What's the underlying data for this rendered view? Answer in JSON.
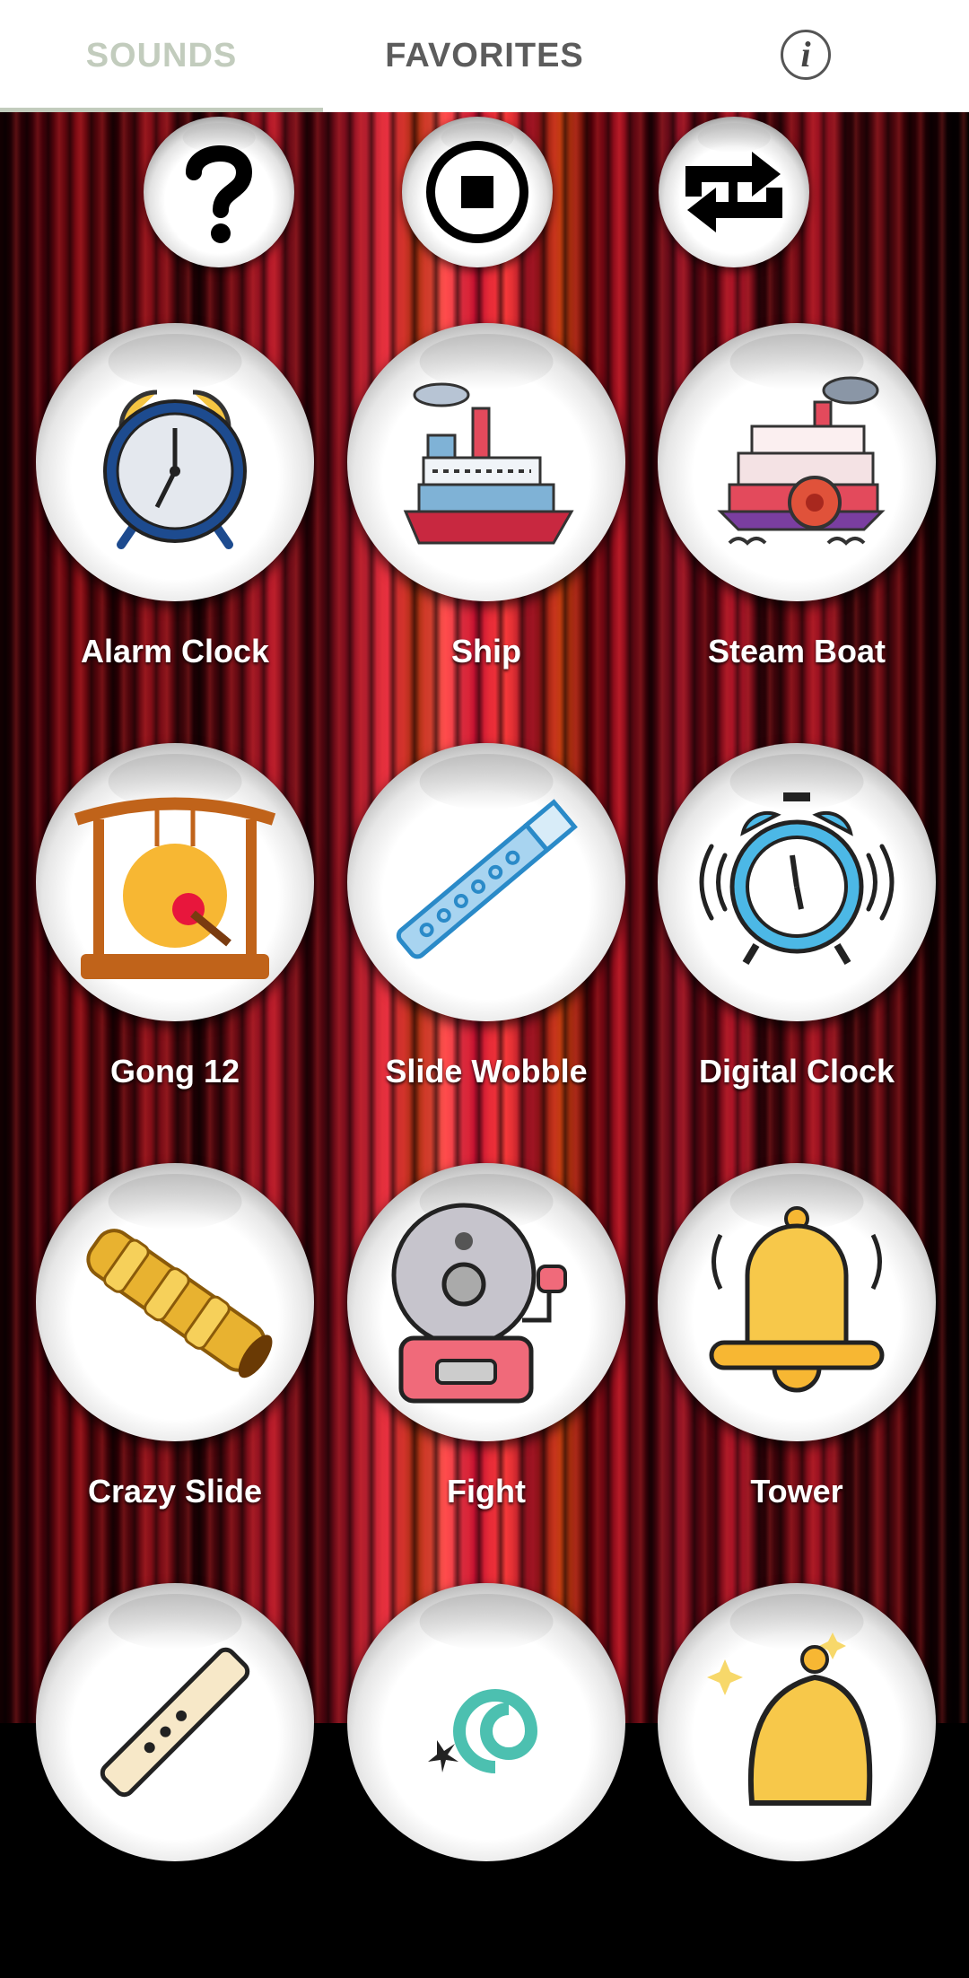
{
  "tabs": {
    "sounds": "SOUNDS",
    "favorites": "FAVORITES",
    "active": "sounds"
  },
  "info_icon": "info-icon",
  "controls": [
    {
      "name": "help",
      "icon": "question-icon"
    },
    {
      "name": "stop",
      "icon": "stop-icon"
    },
    {
      "name": "repeat",
      "icon": "repeat-icon"
    }
  ],
  "sounds": [
    {
      "label": "Alarm Clock",
      "icon": "alarm-clock-icon"
    },
    {
      "label": "Ship",
      "icon": "ship-icon"
    },
    {
      "label": "Steam Boat",
      "icon": "steam-boat-icon"
    },
    {
      "label": "Gong 12",
      "icon": "gong-icon"
    },
    {
      "label": "Slide Wobble",
      "icon": "flute-icon"
    },
    {
      "label": "Digital Clock",
      "icon": "ringing-clock-icon"
    },
    {
      "label": "Crazy Slide",
      "icon": "slide-whistle-icon"
    },
    {
      "label": "Fight",
      "icon": "fight-bell-icon"
    },
    {
      "label": "Tower",
      "icon": "bell-icon"
    },
    {
      "label": "",
      "icon": "recorder-icon"
    },
    {
      "label": "",
      "icon": "party-horn-icon"
    },
    {
      "label": "",
      "icon": "sparkle-bell-icon"
    }
  ],
  "colors": {
    "tab_active": "#c2ccbd",
    "tab_inactive": "#5c5c5c",
    "curtain_red": "#b01828"
  }
}
